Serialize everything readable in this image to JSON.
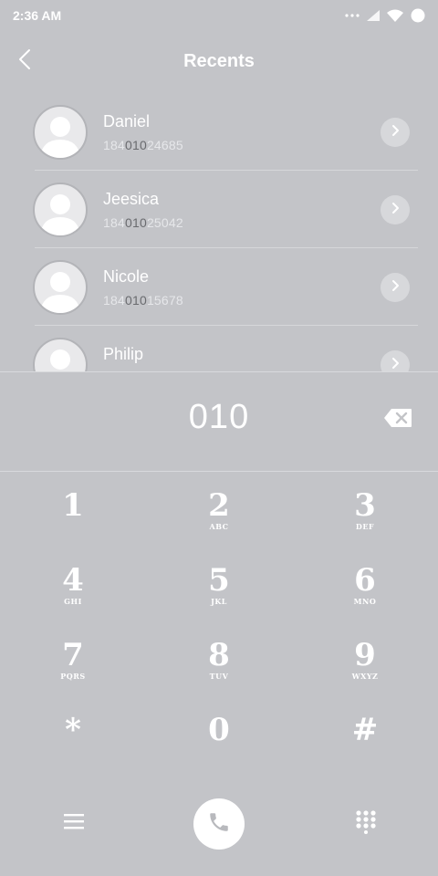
{
  "status_bar": {
    "time": "2:36 AM",
    "icons": [
      "more-dots-icon",
      "signal-icon",
      "wifi-icon",
      "battery-icon"
    ]
  },
  "header": {
    "title": "Recents",
    "back_icon": "chevron-left-icon"
  },
  "recents": [
    {
      "name": "Daniel",
      "number_pre": "184",
      "number_match": "010",
      "number_post": "24685"
    },
    {
      "name": "Jeesica",
      "number_pre": "184",
      "number_match": "010",
      "number_post": "25042"
    },
    {
      "name": "Nicole",
      "number_pre": "184",
      "number_match": "010",
      "number_post": "15678"
    },
    {
      "name": "Philip",
      "number_pre": "",
      "number_match": "",
      "number_post": ""
    }
  ],
  "dialer": {
    "input_value": "010",
    "backspace_icon": "backspace-icon"
  },
  "keypad": [
    {
      "digit": "1",
      "letters": ""
    },
    {
      "digit": "2",
      "letters": "ABC"
    },
    {
      "digit": "3",
      "letters": "DEF"
    },
    {
      "digit": "4",
      "letters": "GHI"
    },
    {
      "digit": "5",
      "letters": "JKL"
    },
    {
      "digit": "6",
      "letters": "MNO"
    },
    {
      "digit": "7",
      "letters": "PQRS"
    },
    {
      "digit": "8",
      "letters": "TUV"
    },
    {
      "digit": "9",
      "letters": "WXYZ"
    },
    {
      "digit": "*",
      "letters": ""
    },
    {
      "digit": "0",
      "letters": ""
    },
    {
      "digit": "#",
      "letters": ""
    }
  ],
  "bottom_bar": {
    "menu_icon": "menu-icon",
    "call_icon": "phone-icon",
    "keypad_icon": "dialpad-icon"
  },
  "colors": {
    "background": "#c3c4c8",
    "text": "#ffffff",
    "match_highlight": "#6a6b6f",
    "call_button": "#ffffff"
  }
}
